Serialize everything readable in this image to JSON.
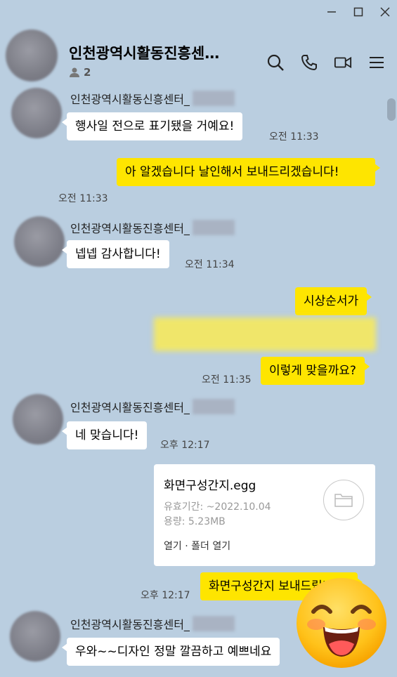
{
  "window": {
    "minimize_icon": "minimize-icon",
    "maximize_icon": "maximize-icon",
    "close_icon": "close-icon"
  },
  "header": {
    "title": "인천광역시활동진흥센…",
    "member_count": "2",
    "tools": [
      "search-icon",
      "phone-icon",
      "video-call-icon",
      "menu-icon"
    ]
  },
  "messages": [
    {
      "type": "received",
      "sender": "인천광역시활동신흥센터_",
      "text": "행사일 전으로 표기됐을 거예요!",
      "time": "오전 11:33"
    },
    {
      "type": "sent",
      "text": "아 알겠습니다 날인해서 보내드리겠습니다!",
      "time": "오전 11:33"
    },
    {
      "type": "received",
      "sender": "인천광역시활동진흥센터_",
      "text": "넵넵 감사합니다!",
      "time": "오전 11:34"
    },
    {
      "type": "sent",
      "text": "시상순서가"
    },
    {
      "type": "sent",
      "text": "이렇게 맞을까요?",
      "time": "오전 11:35"
    },
    {
      "type": "received",
      "sender": "인천광역시활동진흥센터_",
      "text": "네 맞습니다!",
      "time": "오후 12:17"
    },
    {
      "type": "file",
      "filename": "화면구성간지.egg",
      "expiry": "유효기간: ~2022.10.04",
      "size": "용량: 5.23MB",
      "open": "열기",
      "separator": "·",
      "open_folder": "폴더 열기"
    },
    {
      "type": "sent",
      "text": "화면구성간지 보내드립니다!",
      "time": "오후 12:17"
    },
    {
      "type": "received",
      "sender": "인천광역시활동진흥센터_",
      "text": "우와~~디자인 정말 깔끔하고 예쁘네요"
    }
  ],
  "colors": {
    "background": "#bacee0",
    "sent_bubble": "#fee500",
    "received_bubble": "#ffffff"
  }
}
